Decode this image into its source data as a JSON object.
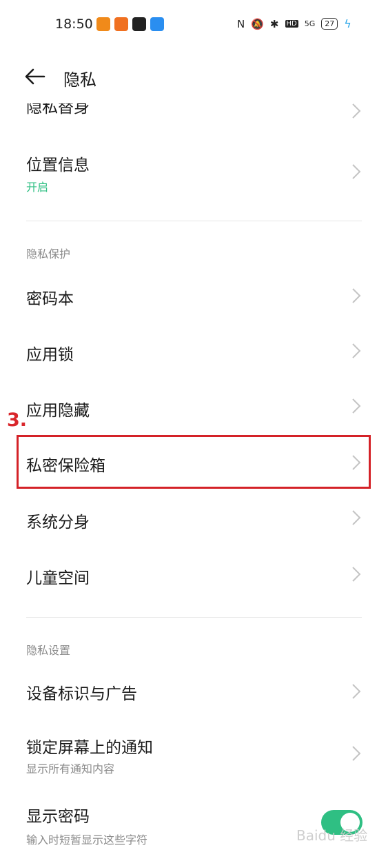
{
  "status_bar": {
    "time": "18:50",
    "sig": "5G",
    "battery": "27",
    "hd": "HD",
    "app_colors": [
      "#f08a1a",
      "#f07020",
      "#222222",
      "#2a8ef0"
    ]
  },
  "header": {
    "title": "隐私"
  },
  "rows_top": [
    {
      "label": "隐私替身"
    },
    {
      "label": "位置信息",
      "sub": "开启"
    }
  ],
  "section_protect": "隐私保护",
  "rows_protect": [
    {
      "label": "密码本"
    },
    {
      "label": "应用锁"
    },
    {
      "label": "应用隐藏"
    },
    {
      "label": "私密保险箱"
    },
    {
      "label": "系统分身"
    },
    {
      "label": "儿童空间"
    }
  ],
  "annotation": {
    "step": "3."
  },
  "section_settings": "隐私设置",
  "rows_settings": [
    {
      "label": "设备标识与广告"
    },
    {
      "label": "锁定屏幕上的通知",
      "sub": "显示所有通知内容"
    },
    {
      "label": "显示密码",
      "sub": "输入时短暂显示这些字符",
      "toggle_on": true
    }
  ],
  "watermark": "Baidu 经验",
  "colors": {
    "accent_green": "#2fbf83",
    "annotation_red": "#d42228"
  }
}
